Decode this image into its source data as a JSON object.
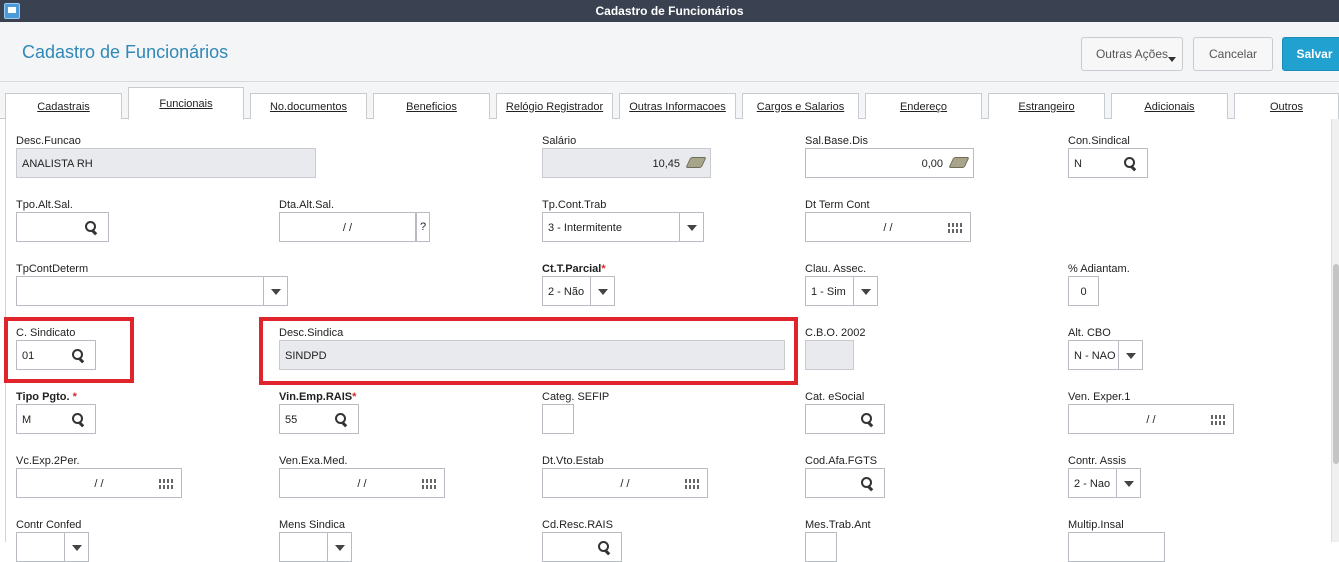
{
  "window": {
    "title": "Cadastro de Funcionários"
  },
  "header": {
    "title": "Cadastro de Funcionários",
    "buttons": {
      "outras": "Outras Ações",
      "cancelar": "Cancelar",
      "salvar": "Salvar"
    }
  },
  "tabs": [
    "Cadastrais",
    "Funcionais",
    "No.documentos",
    "Beneficios",
    "Relógio Registrador",
    "Outras Informacoes",
    "Cargos e Salarios",
    "Endereço",
    "Estrangeiro",
    "Adicionais",
    "Outros"
  ],
  "active_tab": "Funcionais",
  "form": {
    "desc_funcao": {
      "label": "Desc.Funcao",
      "value": "ANALISTA RH"
    },
    "salario": {
      "label": "Salário",
      "value": "10,45"
    },
    "sal_base_dis": {
      "label": "Sal.Base.Dis",
      "value": "0,00"
    },
    "con_sindical": {
      "label": "Con.Sindical",
      "value": "N"
    },
    "tpo_alt_sal": {
      "label": "Tpo.Alt.Sal.",
      "value": ""
    },
    "dta_alt_sal": {
      "label": "Dta.Alt.Sal.",
      "value": "/ /",
      "help": "?"
    },
    "tp_cont_trab": {
      "label": "Tp.Cont.Trab",
      "value": "3 - Intermitente"
    },
    "dt_term_cont": {
      "label": "Dt Term Cont",
      "value": "/ /"
    },
    "tp_cont_determ": {
      "label": "TpContDeterm",
      "value": ""
    },
    "ct_t_parcial": {
      "label": "Ct.T.Parcial",
      "value": "2 - Não"
    },
    "clau_assec": {
      "label": "Clau. Assec.",
      "value": "1 - Sim"
    },
    "pct_adiantam": {
      "label": "% Adiantam.",
      "value": "0"
    },
    "c_sindicato": {
      "label": "C. Sindicato",
      "value": "01"
    },
    "desc_sindica": {
      "label": "Desc.Sindica",
      "value": "SINDPD"
    },
    "cbo_2002": {
      "label": "C.B.O. 2002",
      "value": ""
    },
    "alt_cbo": {
      "label": "Alt. CBO",
      "value": "N - NAO"
    },
    "tipo_pgto": {
      "label": "Tipo Pgto.",
      "value": "M"
    },
    "vin_emp_rais": {
      "label": "Vin.Emp.RAIS",
      "value": "55"
    },
    "categ_sefip": {
      "label": "Categ. SEFIP",
      "value": ""
    },
    "cat_esocial": {
      "label": "Cat. eSocial",
      "value": ""
    },
    "ven_exper_1": {
      "label": "Ven. Exper.1",
      "value": "/ /"
    },
    "vc_exp_2per": {
      "label": "Vc.Exp.2Per.",
      "value": "/ /"
    },
    "ven_exa_med": {
      "label": "Ven.Exa.Med.",
      "value": "/ /"
    },
    "dt_vto_estab": {
      "label": "Dt.Vto.Estab",
      "value": "/ /"
    },
    "cod_afa_fgts": {
      "label": "Cod.Afa.FGTS",
      "value": ""
    },
    "contr_assis": {
      "label": "Contr. Assis",
      "value": "2 - Nao"
    },
    "contr_confed": {
      "label": "Contr Confed"
    },
    "mens_sindica": {
      "label": "Mens Sindica"
    },
    "cd_resc_rais": {
      "label": "Cd.Resc.RAIS"
    },
    "mes_trab_ant": {
      "label": "Mes.Trab.Ant"
    },
    "multip_insal": {
      "label": "Multip.Insal"
    }
  },
  "colors": {
    "accent": "#20a1d0",
    "title": "#2f88b8",
    "highlight": "#e0242b"
  }
}
